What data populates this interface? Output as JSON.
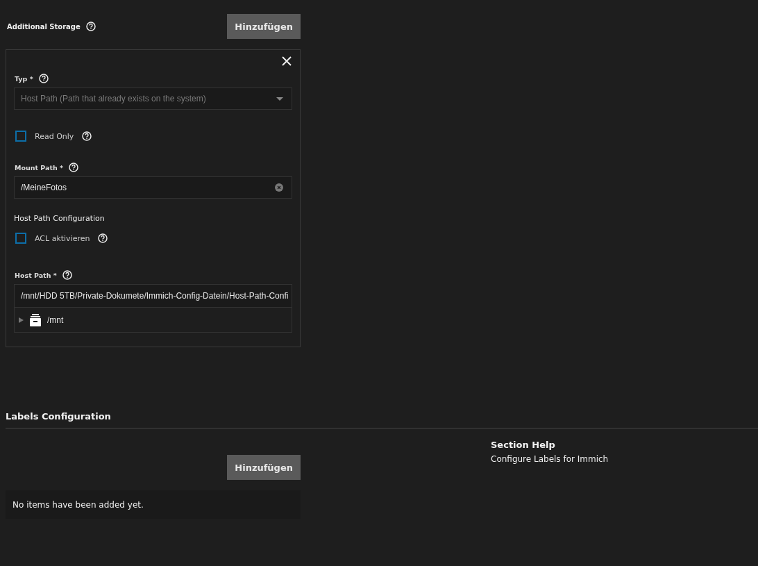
{
  "additional_storage": {
    "title": "Additional Storage",
    "add_button": "Hinzufügen",
    "item": {
      "type_field": {
        "label": "Typ *",
        "value": "Host Path (Path that already exists on the system)",
        "disabled": true
      },
      "read_only": {
        "label": "Read Only",
        "checked": false
      },
      "mount_path": {
        "label": "Mount Path *",
        "value": "/MeineFotos"
      },
      "host_path_config": {
        "title": "Host Path Configuration",
        "acl": {
          "label": "ACL aktivieren",
          "checked": false
        },
        "host_path": {
          "label": "Host Path *",
          "value": "/mnt/HDD 5TB/Private-Dokumete/Immich-Config-Datein/Host-Path-Confi",
          "tree": [
            {
              "label": "/mnt",
              "expanded": false
            }
          ]
        }
      }
    }
  },
  "labels_configuration": {
    "title": "Labels Configuration",
    "add_button": "Hinzufügen",
    "empty_text": "No items have been added yet.",
    "section_help": {
      "title": "Section Help",
      "text": "Configure Labels for Immich"
    }
  }
}
